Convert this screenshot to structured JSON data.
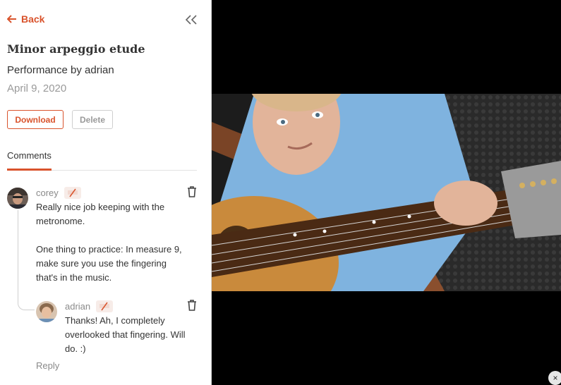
{
  "nav": {
    "back_label": "Back"
  },
  "performance": {
    "title": "Minor arpeggio etude",
    "performer": "Performance by adrian",
    "date": "April 9, 2020"
  },
  "actions": {
    "download_label": "Download",
    "delete_label": "Delete"
  },
  "tabs": [
    {
      "label": "Comments",
      "active": true
    }
  ],
  "comments": [
    {
      "author": "corey",
      "lines": [
        "Really nice job keeping with the",
        "metronome.",
        "",
        "One thing to practice: In measure 9,",
        "make sure you use the fingering",
        "that's in the music."
      ],
      "replies": [
        {
          "author": "adrian",
          "lines": [
            "Thanks! Ah, I completely",
            "overlooked that fingering. Will",
            "do. :)"
          ]
        }
      ],
      "reply_label": "Reply"
    }
  ],
  "video": {
    "close_glyph": "×"
  },
  "colors": {
    "accent": "#d9532c",
    "muted": "#9a9a9a"
  },
  "icons": [
    "arrow-left-icon",
    "double-chevron-left-icon",
    "trash-icon",
    "music-badge-icon",
    "close-icon"
  ]
}
